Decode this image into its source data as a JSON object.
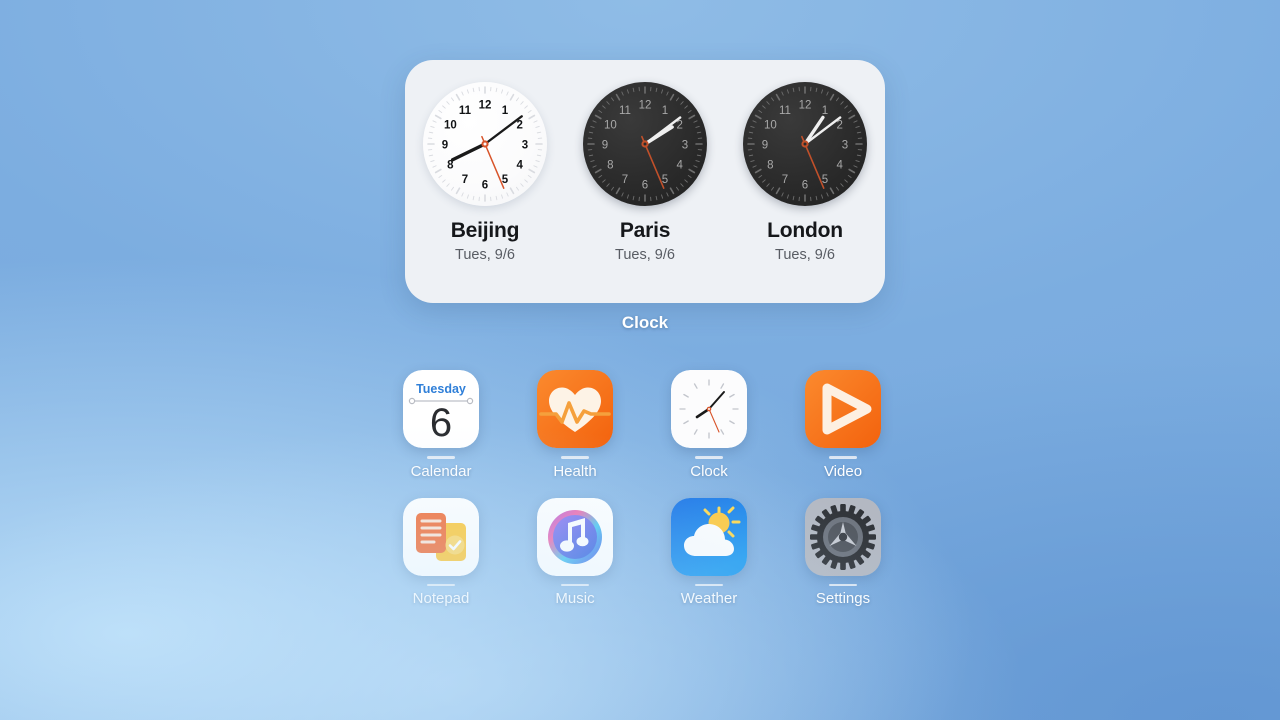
{
  "wallpaper": {
    "top_left_color": "#8CB9E3",
    "top_right_color": "#79AAD8",
    "bottom_left_color": "#A8D4F5",
    "bottom_right_color": "#6A9BD2"
  },
  "widget": {
    "label": "Clock",
    "card_color": "#EEF1F5",
    "clocks": [
      {
        "city": "Beijing",
        "date": "Tues, 9/6",
        "theme": "light",
        "hour_deg": 244,
        "minute_deg": 53,
        "second_deg": 157,
        "numerals": [
          "12",
          "1",
          "2",
          "3",
          "4",
          "5",
          "6",
          "7",
          "8",
          "9",
          "10",
          "11"
        ]
      },
      {
        "city": "Paris",
        "date": "Tues, 9/6",
        "theme": "dark",
        "hour_deg": 58,
        "minute_deg": 53,
        "second_deg": 157,
        "numerals": [
          "12",
          "1",
          "2",
          "3",
          "4",
          "5",
          "6",
          "7",
          "8",
          "9",
          "10",
          "11"
        ]
      },
      {
        "city": "London",
        "date": "Tues, 9/6",
        "theme": "dark",
        "hour_deg": 34,
        "minute_deg": 53,
        "second_deg": 157,
        "numerals": [
          "12",
          "1",
          "2",
          "3",
          "4",
          "5",
          "6",
          "7",
          "8",
          "9",
          "10",
          "11"
        ]
      }
    ]
  },
  "apps": {
    "rows": [
      [
        {
          "name": "Calendar",
          "icon": "calendar-icon",
          "weekday": "Tuesday",
          "day": "6",
          "accent": "#2f7fd8"
        },
        {
          "name": "Health",
          "icon": "health-heart-icon",
          "accent": "#F97316"
        },
        {
          "name": "Clock",
          "icon": "clock-icon",
          "accent": "#FFFFFF"
        },
        {
          "name": "Video",
          "icon": "video-play-icon",
          "accent": "#F97316"
        }
      ],
      [
        {
          "name": "Notepad",
          "icon": "notepad-icon",
          "accent": "#F2733B"
        },
        {
          "name": "Music",
          "icon": "music-note-icon",
          "accent": "#6B5CE7"
        },
        {
          "name": "Weather",
          "icon": "weather-sun-cloud-icon",
          "accent": "#1577E0"
        },
        {
          "name": "Settings",
          "icon": "settings-gear-icon",
          "accent": "#9AA0AA"
        }
      ]
    ]
  }
}
